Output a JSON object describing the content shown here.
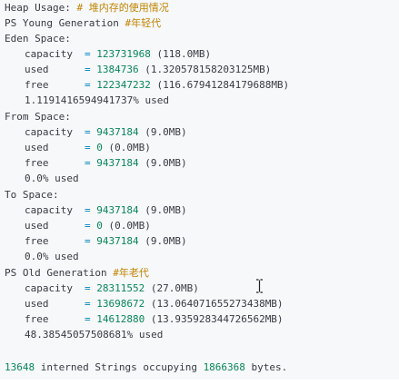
{
  "header": {
    "label": "Heap Usage:",
    "comment": "# 堆内存的使用情况"
  },
  "young_gen": {
    "label": "PS Young Generation",
    "comment": "#年轻代"
  },
  "eden": {
    "label": "Eden Space:",
    "capacity_key": "capacity",
    "capacity_val": "123731968",
    "capacity_mb": "(118.0MB)",
    "used_key": "used",
    "used_val": "1384736",
    "used_mb": "(1.320578158203125MB)",
    "free_key": "free",
    "free_val": "122347232",
    "free_mb": "(116.67941284179688MB)",
    "pct": "1.1191416594941737% used"
  },
  "from": {
    "label": "From Space:",
    "capacity_key": "capacity",
    "capacity_val": "9437184",
    "capacity_mb": "(9.0MB)",
    "used_key": "used",
    "used_val": "0",
    "used_mb": "(0.0MB)",
    "free_key": "free",
    "free_val": "9437184",
    "free_mb": "(9.0MB)",
    "pct": "0.0% used"
  },
  "to": {
    "label": "To Space:",
    "capacity_key": "capacity",
    "capacity_val": "9437184",
    "capacity_mb": "(9.0MB)",
    "used_key": "used",
    "used_val": "0",
    "used_mb": "(0.0MB)",
    "free_key": "free",
    "free_val": "9437184",
    "free_mb": "(9.0MB)",
    "pct": "0.0% used"
  },
  "old_gen": {
    "label": "PS Old Generation",
    "comment": "#年老代",
    "capacity_key": "capacity",
    "capacity_val": "28311552",
    "capacity_mb": "(27.0MB)",
    "used_key": "used",
    "used_val": "13698672",
    "used_mb": "(13.064071655273438MB)",
    "free_key": "free",
    "free_val": "14612880",
    "free_mb": "(13.935928344726562MB)",
    "pct": "48.38545057508681% used"
  },
  "footer": {
    "count": "13648",
    "text": "interned Strings occupying",
    "bytes": "1866368",
    "suffix": "bytes."
  },
  "operator": "=",
  "cursor_icon": "text-cursor-icon"
}
